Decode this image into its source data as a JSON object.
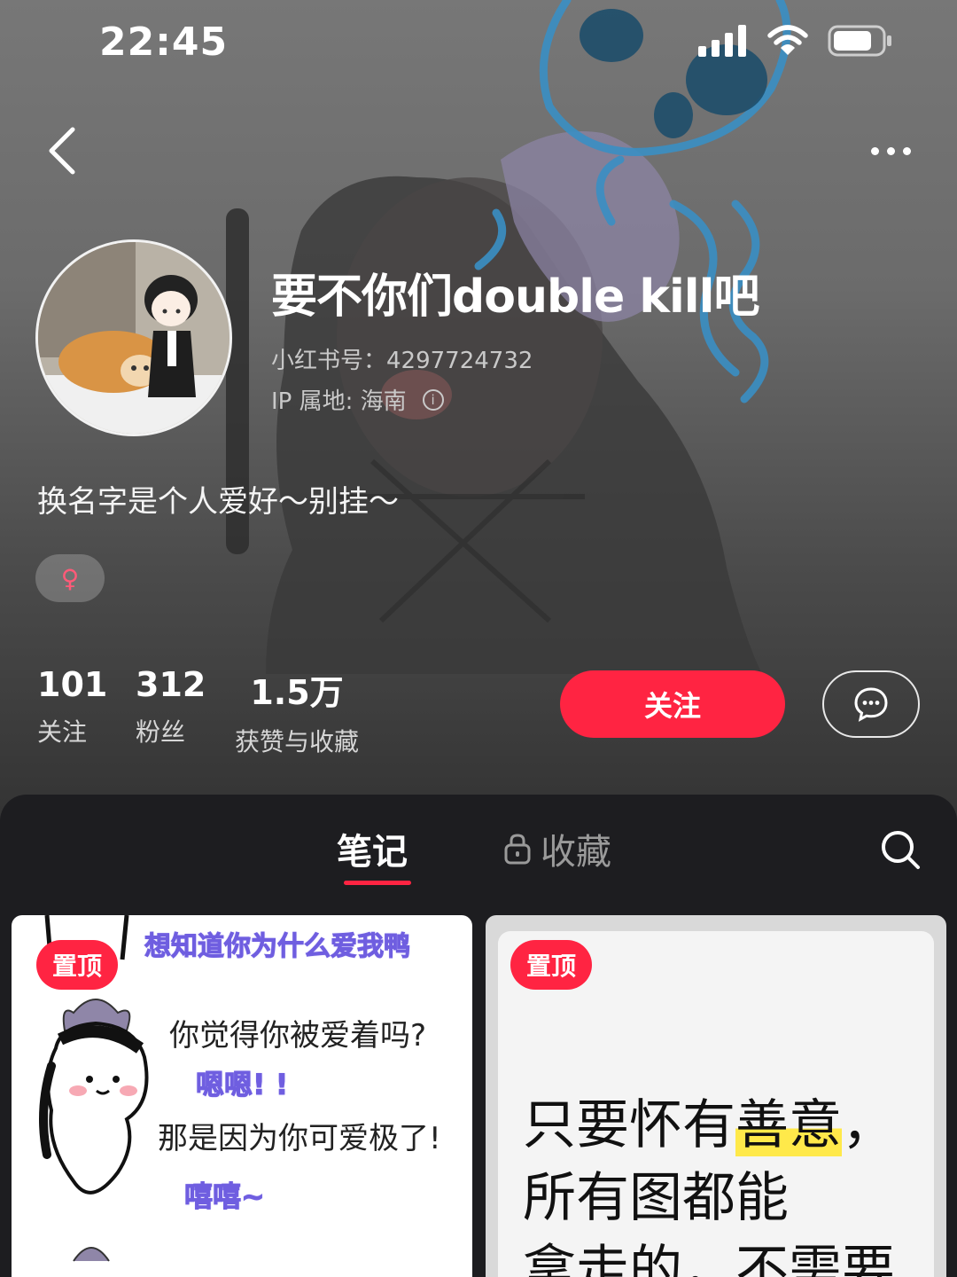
{
  "status": {
    "time": "22:45"
  },
  "profile": {
    "nickname": "要不你们double kill吧",
    "red_id": "小红书号：4297724732",
    "ip_location": "IP 属地: 海南",
    "bio": "换名字是个人爱好～别挂～",
    "gender_symbol": "♀"
  },
  "stats": {
    "following": {
      "value": "101",
      "label": "关注"
    },
    "followers": {
      "value": "312",
      "label": "粉丝"
    },
    "likes": {
      "value": "1.5万",
      "label": "获赞与收藏"
    }
  },
  "actions": {
    "follow_label": "关注"
  },
  "tabs": {
    "notes": "笔记",
    "collections": "收藏"
  },
  "notes": [
    {
      "pin": "置顶",
      "lines": [
        "想知道你为什么爱我鸭",
        "你觉得你被爱着吗?",
        "嗯嗯! !",
        "那是因为你可爱极了!",
        "嘻嘻~"
      ]
    },
    {
      "pin": "置顶",
      "lines": [
        "只要怀有",
        "善意",
        "，",
        "所有图都能",
        "拿走的，不需要"
      ]
    }
  ],
  "colors": {
    "accent": "#ff2442",
    "background": "#1d1d20",
    "gender": "#ff5a78",
    "dialog_purple": "#6f5ee0"
  }
}
